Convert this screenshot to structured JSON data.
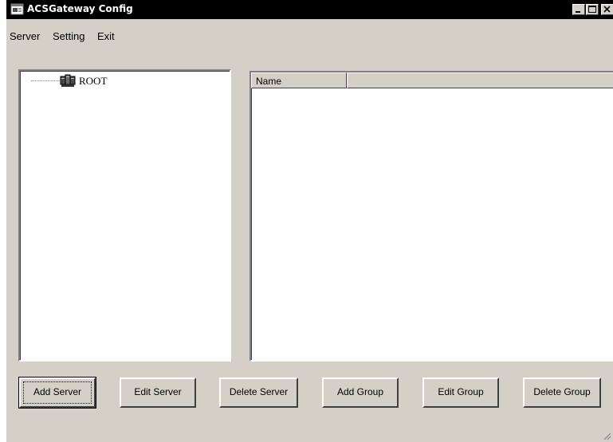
{
  "window": {
    "title": "ACSGateway Config",
    "app_icon": "app-window-icon",
    "controls": [
      "minimize-icon",
      "maximize-icon",
      "close-icon"
    ]
  },
  "menu": {
    "items": [
      {
        "label": "Server"
      },
      {
        "label": "Setting"
      },
      {
        "label": "Exit"
      }
    ]
  },
  "tree": {
    "root": {
      "label": "ROOT",
      "icon": "server-group-icon"
    }
  },
  "list": {
    "columns": [
      {
        "label": "Name"
      },
      {
        "label": ""
      }
    ],
    "rows": []
  },
  "buttons": {
    "add_server": "Add Server",
    "edit_server": "Edit Server",
    "delete_server": "Delete Server",
    "add_group": "Add Group",
    "edit_group": "Edit Group",
    "delete_group": "Delete Group"
  },
  "colors": {
    "titlebar": "#000000",
    "window_face": "#d4d0c8",
    "pane_background": "#ffffff"
  }
}
